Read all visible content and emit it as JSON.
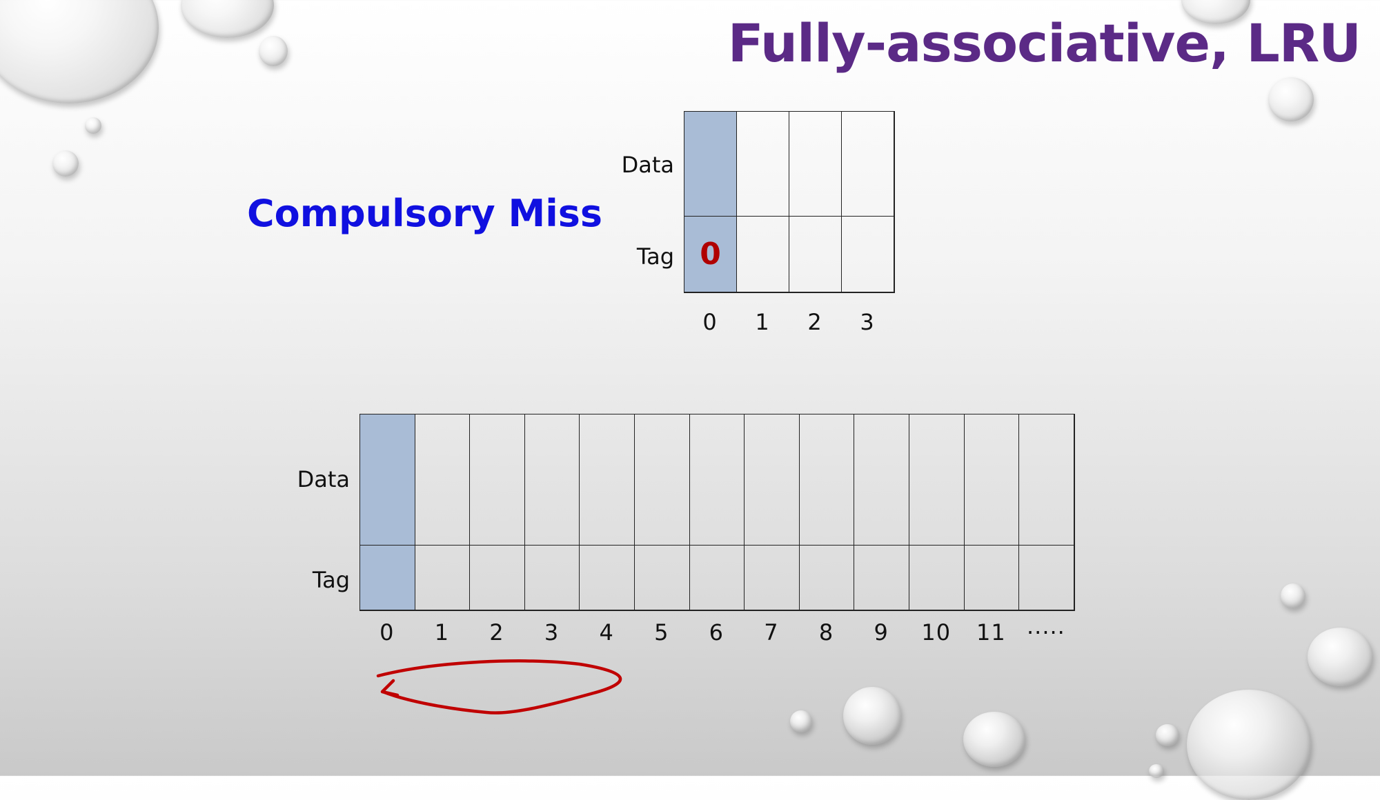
{
  "title": "Fully-associative, LRU",
  "subtitle": "Compulsory Miss",
  "cache": {
    "labels": {
      "data": "Data",
      "tag": "Tag"
    },
    "tags": [
      "0",
      "",
      "",
      ""
    ],
    "filled": [
      true,
      false,
      false,
      false
    ],
    "indices": [
      "0",
      "1",
      "2",
      "3"
    ]
  },
  "memory": {
    "labels": {
      "data": "Data",
      "tag": "Tag"
    },
    "filled": [
      true,
      false,
      false,
      false,
      false,
      false,
      false,
      false,
      false,
      false,
      false,
      false,
      false
    ],
    "indices": [
      "0",
      "1",
      "2",
      "3",
      "4",
      "5",
      "6",
      "7",
      "8",
      "9",
      "10",
      "11",
      "·····"
    ]
  },
  "colors": {
    "title": "#5b2a86",
    "subtitle": "#1010e0",
    "filled_cell": "#a9bcd6",
    "tag_value": "#b00000",
    "arrow": "#c00000"
  }
}
